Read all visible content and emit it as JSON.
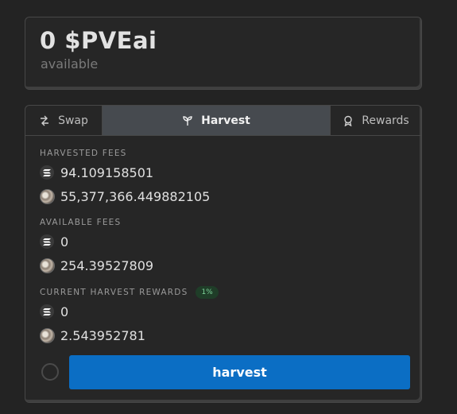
{
  "balance": {
    "amount": "0 $PVEai",
    "caption": "available"
  },
  "tabs": [
    {
      "label": "Swap",
      "icon": "swap-icon"
    },
    {
      "label": "Harvest",
      "icon": "sprout-icon"
    },
    {
      "label": "Rewards",
      "icon": "award-icon"
    }
  ],
  "active_tab": "Harvest",
  "harvested_fees": {
    "label": "HARVESTED FEES",
    "sol": "94.109158501",
    "token": "55,377,366.449882105"
  },
  "available_fees": {
    "label": "AVAILABLE FEES",
    "sol": "0",
    "token": "254.39527809"
  },
  "current_rewards": {
    "label": "CURRENT HARVEST REWARDS",
    "badge": "1%",
    "sol": "0",
    "token": "2.543952781"
  },
  "harvest_button": "harvest",
  "colors": {
    "accent": "#0b6ec4",
    "badge_bg": "#1f3d28",
    "badge_text": "#7ed39a"
  }
}
